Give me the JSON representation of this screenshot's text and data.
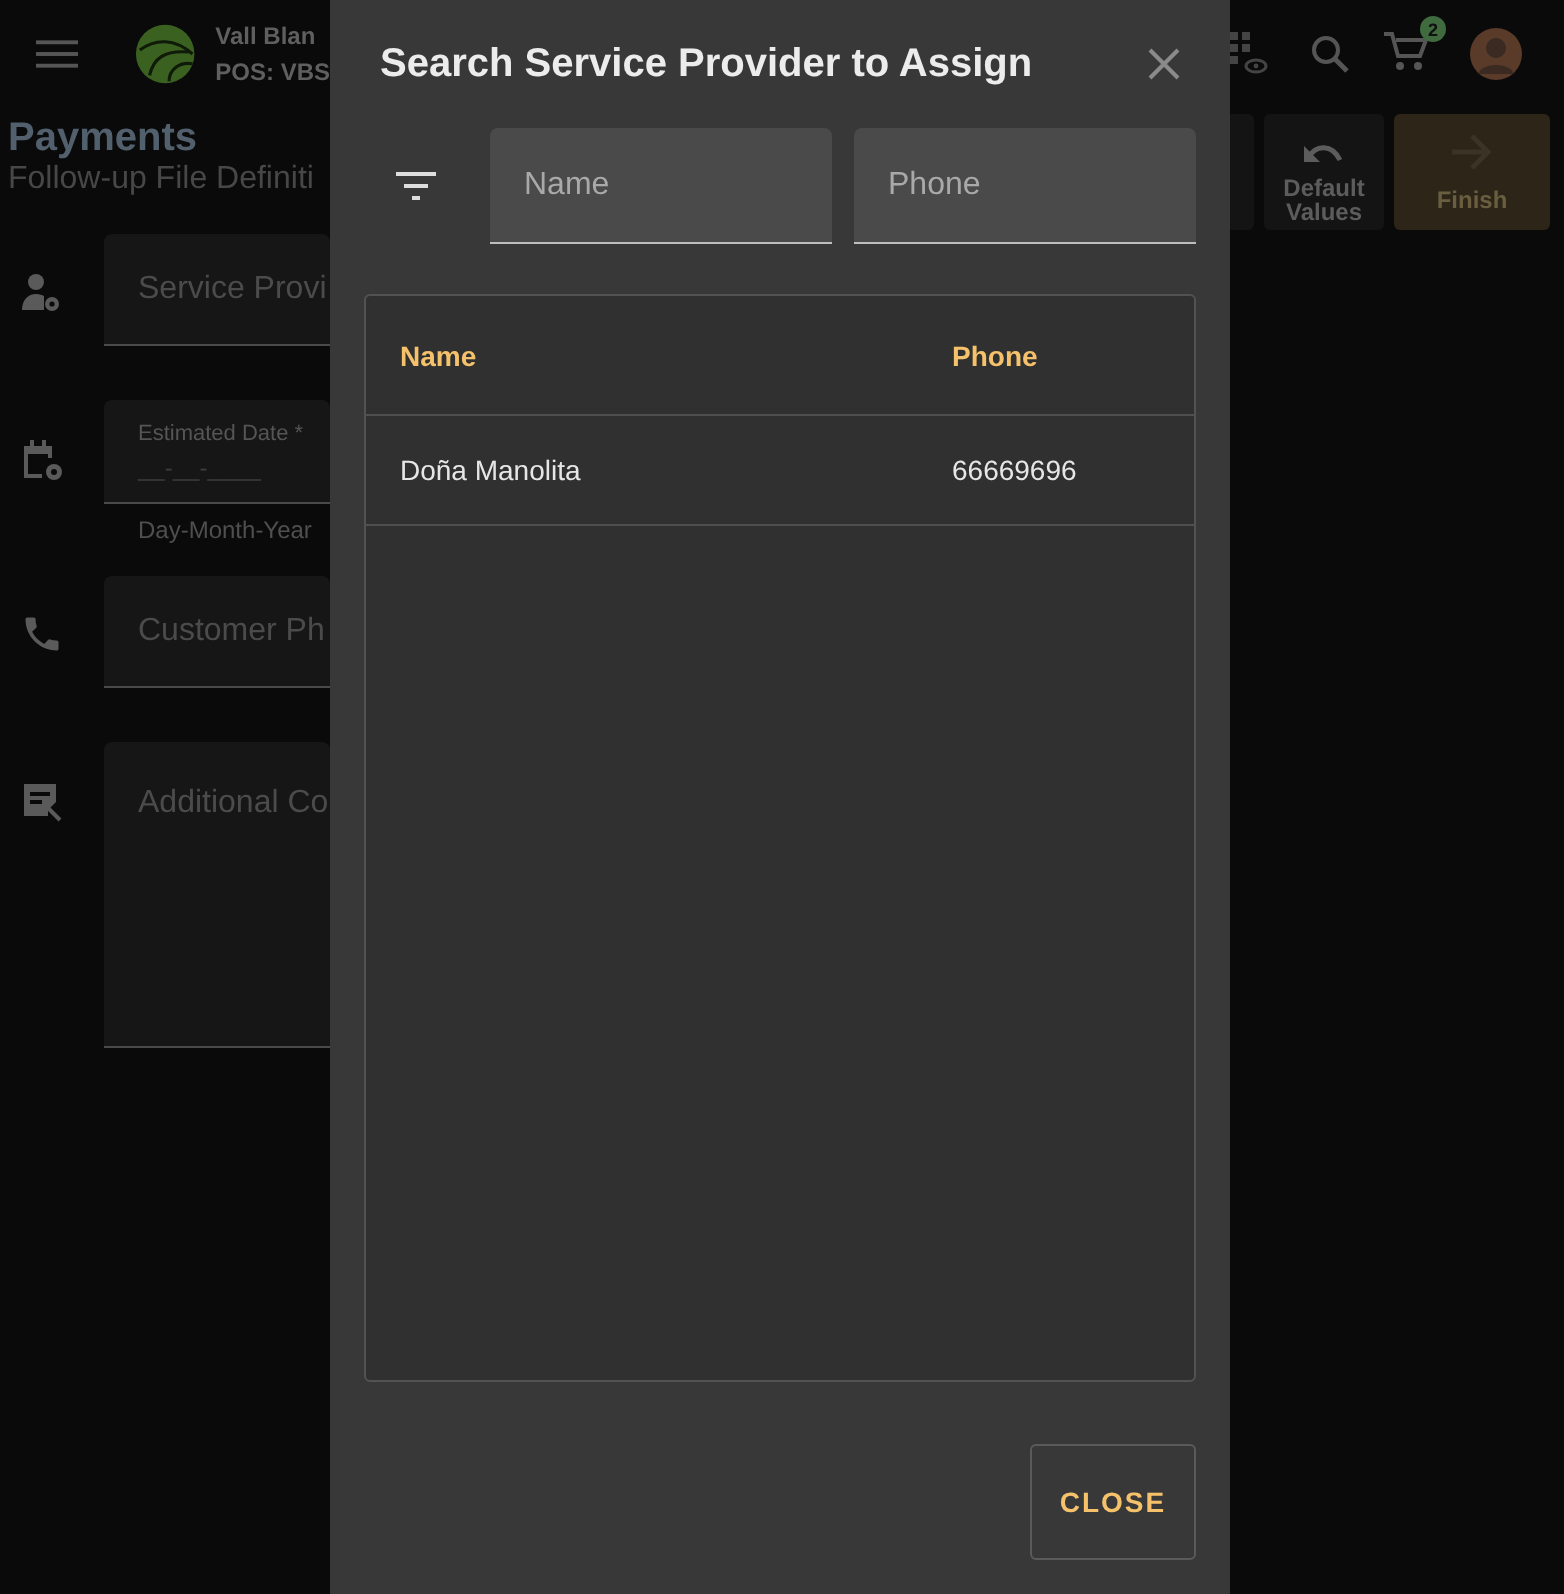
{
  "app_bar": {
    "org_name": "Vall Blan",
    "pos": "POS: VBS",
    "cart_count": "2"
  },
  "page": {
    "title": "Payments",
    "subtitle": "Follow-up File Definiti"
  },
  "form_fields": [
    {
      "kind": "text",
      "label": "Service Provi"
    },
    {
      "kind": "date",
      "label": "Estimated Date *",
      "mask": "__-__-____",
      "hint": "Day-Month-Year"
    },
    {
      "kind": "text",
      "label": "Customer Ph"
    },
    {
      "kind": "textarea",
      "label": "Additional Co"
    }
  ],
  "actions": [
    {
      "label": "Default Values",
      "kind": "default"
    },
    {
      "label": "Finish",
      "kind": "primary"
    }
  ],
  "dialog": {
    "title": "Search Service Provider to Assign",
    "filters": [
      {
        "placeholder": "Name"
      },
      {
        "placeholder": "Phone"
      }
    ],
    "table": {
      "columns": [
        "Name",
        "Phone"
      ],
      "rows": [
        [
          "Doña Manolita",
          "66669696"
        ]
      ]
    },
    "close_button": "CLOSE"
  }
}
